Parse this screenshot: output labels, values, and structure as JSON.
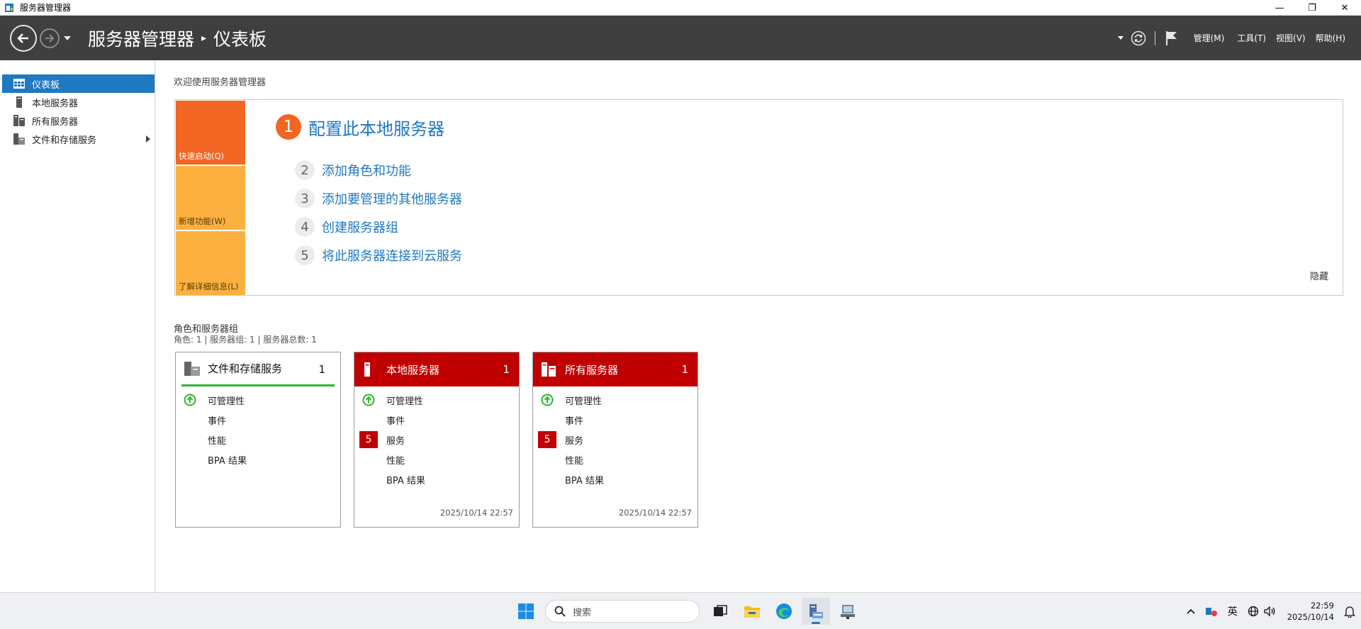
{
  "window": {
    "title": "服务器管理器",
    "controls": {
      "minimize": "—",
      "maximize": "❐",
      "close": "✕"
    }
  },
  "header": {
    "app_name": "服务器管理器",
    "separator": "▸",
    "page": "仪表板",
    "menus": [
      "管理(M)",
      "工具(T)",
      "视图(V)",
      "帮助(H)"
    ]
  },
  "sidebar": {
    "items": [
      {
        "label": "仪表板",
        "icon": "dashboard-icon",
        "active": true
      },
      {
        "label": "本地服务器",
        "icon": "server-icon"
      },
      {
        "label": "所有服务器",
        "icon": "servers-icon"
      },
      {
        "label": "文件和存储服务",
        "icon": "file-storage-icon",
        "expandable": true
      }
    ]
  },
  "main": {
    "welcome": "欢迎使用服务器管理器",
    "quickstart": {
      "tiles": [
        "快速启动(Q)",
        "新增功能(W)",
        "了解详细信息(L)"
      ],
      "steps": [
        {
          "num": "1",
          "text": "配置此本地服务器"
        },
        {
          "num": "2",
          "text": "添加角色和功能"
        },
        {
          "num": "3",
          "text": "添加要管理的其他服务器"
        },
        {
          "num": "4",
          "text": "创建服务器组"
        },
        {
          "num": "5",
          "text": "将此服务器连接到云服务"
        }
      ],
      "hide": "隐藏"
    },
    "roles": {
      "title": "角色和服务器组",
      "subtitle": "角色: 1 | 服务器组: 1 | 服务器总数: 1",
      "cards": [
        {
          "name": "文件和存储服务",
          "count": "1",
          "style": "white",
          "rows": [
            {
              "badge": "up-arrow-icon",
              "label": "可管理性"
            },
            {
              "label": "事件"
            },
            {
              "label": "性能"
            },
            {
              "label": "BPA 结果"
            }
          ],
          "timestamp": ""
        },
        {
          "name": "本地服务器",
          "count": "1",
          "style": "red",
          "rows": [
            {
              "badge": "up-arrow-icon",
              "label": "可管理性"
            },
            {
              "label": "事件"
            },
            {
              "badge_count": "5",
              "label": "服务"
            },
            {
              "label": "性能"
            },
            {
              "label": "BPA 结果"
            }
          ],
          "timestamp": "2025/10/14 22:57"
        },
        {
          "name": "所有服务器",
          "count": "1",
          "style": "red",
          "rows": [
            {
              "badge": "up-arrow-icon",
              "label": "可管理性"
            },
            {
              "label": "事件"
            },
            {
              "badge_count": "5",
              "label": "服务"
            },
            {
              "label": "性能"
            },
            {
              "label": "BPA 结果"
            }
          ],
          "timestamp": "2025/10/14 22:57"
        }
      ]
    }
  },
  "taskbar": {
    "search_placeholder": "搜索",
    "ime": "英",
    "time": "22:59",
    "date": "2025/10/14"
  },
  "colors": {
    "accent": "#1f78c2",
    "header_bg": "#3f3f3f",
    "quickstart_orange": "#f26522",
    "quickstart_amber": "#fbb040",
    "alert_red": "#c00000",
    "ok_green": "#2fb52f"
  }
}
